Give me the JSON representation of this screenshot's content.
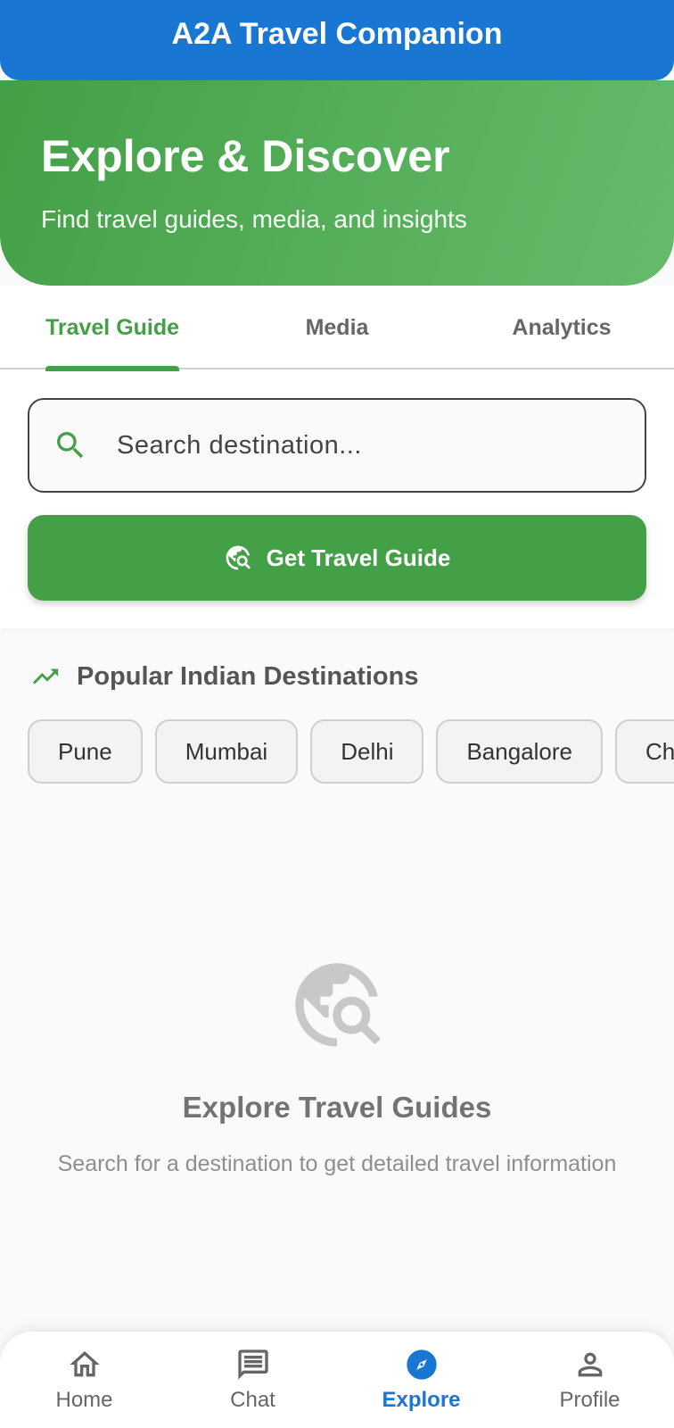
{
  "app": {
    "title": "A2A Travel Companion"
  },
  "hero": {
    "title": "Explore & Discover",
    "subtitle": "Find travel guides, media, and insights"
  },
  "tabs": [
    {
      "label": "Travel Guide",
      "active": true
    },
    {
      "label": "Media",
      "active": false
    },
    {
      "label": "Analytics",
      "active": false
    }
  ],
  "search": {
    "placeholder": "Search destination...",
    "value": ""
  },
  "guide_button": {
    "label": "Get Travel Guide",
    "icon": "travel-explore-icon"
  },
  "popular": {
    "heading": "Popular Indian Destinations",
    "icon": "trending-up-icon",
    "destinations": [
      "Pune",
      "Mumbai",
      "Delhi",
      "Bangalore",
      "Chennai"
    ]
  },
  "empty_state": {
    "icon": "travel-explore-icon",
    "title": "Explore Travel Guides",
    "subtitle": "Search for a destination to get detailed travel information"
  },
  "bottom_nav": [
    {
      "label": "Home",
      "icon": "home-icon",
      "active": false
    },
    {
      "label": "Chat",
      "icon": "chat-icon",
      "active": false
    },
    {
      "label": "Explore",
      "icon": "explore-compass-icon",
      "active": true
    },
    {
      "label": "Profile",
      "icon": "person-icon",
      "active": false
    }
  ],
  "colors": {
    "primary_blue": "#1976d2",
    "accent_green": "#43a047",
    "green_light": "#66bb6a"
  }
}
